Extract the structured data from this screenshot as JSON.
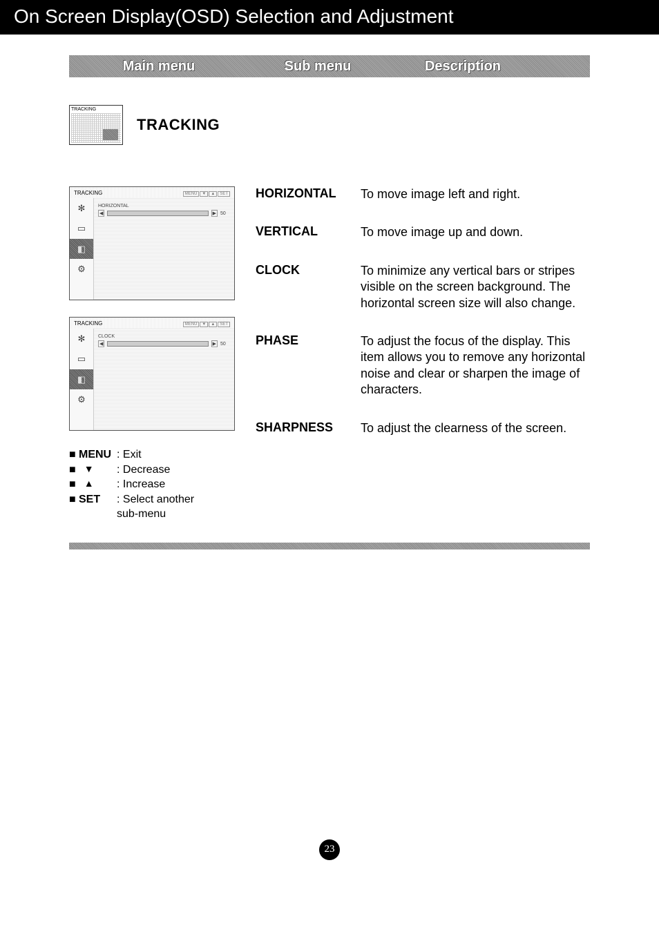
{
  "title": "On Screen Display(OSD) Selection and Adjustment",
  "headers": {
    "main": "Main menu",
    "sub": "Sub menu",
    "desc": "Description"
  },
  "section": {
    "thumb_label": "TRACKING",
    "title": "TRACKING"
  },
  "osd": {
    "header_label": "TRACKING",
    "btn_menu": "MENU",
    "btn_set": "SET",
    "box1_highlight": "HORIZONTAL",
    "box2_highlight": "CLOCK",
    "value": "50"
  },
  "legend": {
    "menu_key": "MENU",
    "menu_text": ": Exit",
    "down_text": ": Decrease",
    "up_text": ": Increase",
    "set_key": "SET",
    "set_text": ": Select another",
    "set_text2": "sub-menu"
  },
  "items": [
    {
      "sub": "HORIZONTAL",
      "desc": "To move image left and right."
    },
    {
      "sub": "VERTICAL",
      "desc": "To move image up and down."
    },
    {
      "sub": "CLOCK",
      "desc": "To minimize any vertical bars or stripes visible on the screen background. The horizontal screen size will also change."
    },
    {
      "sub": "PHASE",
      "desc": "To adjust the focus of the display. This item allows you to remove any horizontal noise and clear or sharpen the image of characters."
    },
    {
      "sub": "SHARPNESS",
      "desc": "To adjust the clearness of the screen."
    }
  ],
  "page_number": "23"
}
